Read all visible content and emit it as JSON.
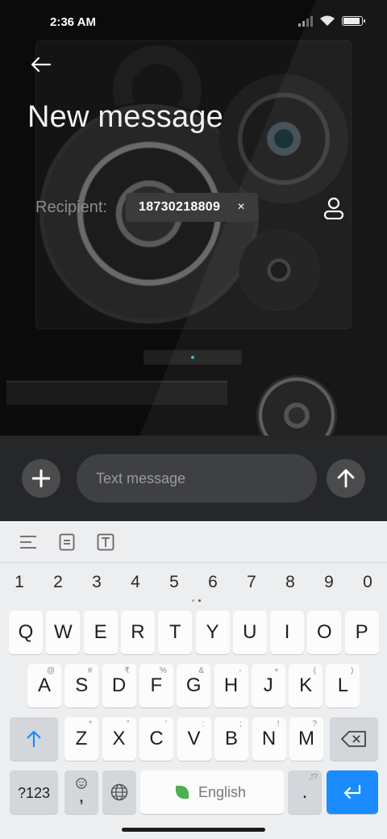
{
  "status_bar": {
    "time": "2:36 AM",
    "battery_level": 0.9,
    "signal_level": 0.5
  },
  "header": {
    "title": "New message"
  },
  "recipient": {
    "label": "Recipient:",
    "chip_number": "18730218809",
    "chip_close": "×"
  },
  "compose": {
    "placeholder": "Text message"
  },
  "keyboard": {
    "numbers": [
      "1",
      "2",
      "3",
      "4",
      "5",
      "6",
      "7",
      "8",
      "9",
      "0"
    ],
    "row1": [
      {
        "k": "Q",
        "h": ""
      },
      {
        "k": "W",
        "h": ""
      },
      {
        "k": "E",
        "h": ""
      },
      {
        "k": "R",
        "h": ""
      },
      {
        "k": "T",
        "h": ""
      },
      {
        "k": "Y",
        "h": ""
      },
      {
        "k": "U",
        "h": ""
      },
      {
        "k": "I",
        "h": ""
      },
      {
        "k": "O",
        "h": ""
      },
      {
        "k": "P",
        "h": ""
      }
    ],
    "row2": [
      {
        "k": "A",
        "h": "@"
      },
      {
        "k": "S",
        "h": "#"
      },
      {
        "k": "D",
        "h": "₹"
      },
      {
        "k": "F",
        "h": "%"
      },
      {
        "k": "G",
        "h": "&"
      },
      {
        "k": "H",
        "h": "-"
      },
      {
        "k": "J",
        "h": "+"
      },
      {
        "k": "K",
        "h": "("
      },
      {
        "k": "L",
        "h": ")"
      }
    ],
    "row3": [
      {
        "k": "Z",
        "h": "*"
      },
      {
        "k": "X",
        "h": "\""
      },
      {
        "k": "C",
        "h": "'"
      },
      {
        "k": "V",
        "h": ":"
      },
      {
        "k": "B",
        "h": ";"
      },
      {
        "k": "N",
        "h": "!"
      },
      {
        "k": "M",
        "h": "?"
      }
    ],
    "symbols_label": "?123",
    "comma": ",",
    "space_label": "English",
    "period": ".",
    "period_hint": ",!?"
  },
  "colors": {
    "accent": "#1a8cff",
    "compose_bg": "#262729",
    "keyboard_bg": "#eceef0"
  }
}
